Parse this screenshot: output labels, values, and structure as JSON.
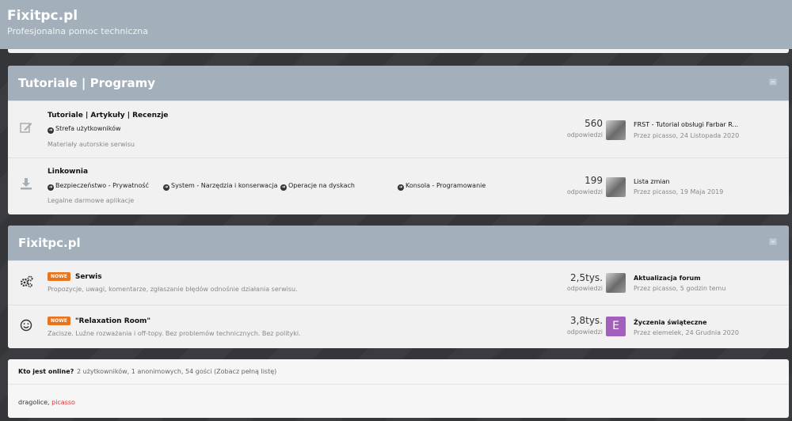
{
  "header": {
    "title": "Fixitpc.pl",
    "tagline": "Profesjonalna pomoc techniczna"
  },
  "categories": [
    {
      "title": "Tutoriale | Programy",
      "forums": [
        {
          "icon": "edit-icon",
          "name": "Tutoriale | Artykuły | Recenzje",
          "subforums": [
            "Strefa użytkowników"
          ],
          "description": "Materiały autorskie serwisu",
          "count": "560",
          "count_label": "odpowiedzi",
          "last_title": "FRST - Tutorial obsługi Farbar R...",
          "last_meta": "Przez picasso, 24 Listopada 2020"
        },
        {
          "icon": "download-icon",
          "name": "Linkownia",
          "subforums": [
            "Bezpieczeństwo - Prywatność",
            "System - Narzędzia i konserwacja",
            "Operacje na dyskach",
            "Konsola - Programowanie"
          ],
          "description": "Legalne darmowe aplikacje",
          "count": "199",
          "count_label": "odpowiedzi",
          "last_title": "Lista zmian",
          "last_meta": "Przez picasso, 19 Maja 2019"
        }
      ]
    },
    {
      "title": "Fixitpc.pl",
      "forums": [
        {
          "icon": "gears-icon",
          "badge": "NOWE",
          "name": "Serwis",
          "description": "Propozycje, uwagi, komentarze, zgłaszanie błędów odnośnie działania serwisu.",
          "count": "2,5tys.",
          "count_label": "odpowiedzi",
          "last_title": "Aktualizacja forum",
          "last_meta": "Przez picasso, 5 godzin temu"
        },
        {
          "icon": "smiley-icon",
          "badge": "NOWE",
          "name": "\"Relaxation Room\"",
          "description": "Zacisze. Luźne rozważania i off-topy. Bez problemów technicznych. Bez polityki.",
          "count": "3,8tys.",
          "count_label": "odpowiedzi",
          "avatar_letter": "E",
          "last_title": "Życzenia świąteczne",
          "last_meta": "Przez elemelek, 24 Grudnia 2020"
        }
      ]
    }
  ],
  "online": {
    "title": "Kto jest online?",
    "stats": "2 użytkowników, 1 anonimowych, 54 gości (Zobacz pełną listę)",
    "user1": "dragolice",
    "separator": ", ",
    "user2": "picasso"
  }
}
